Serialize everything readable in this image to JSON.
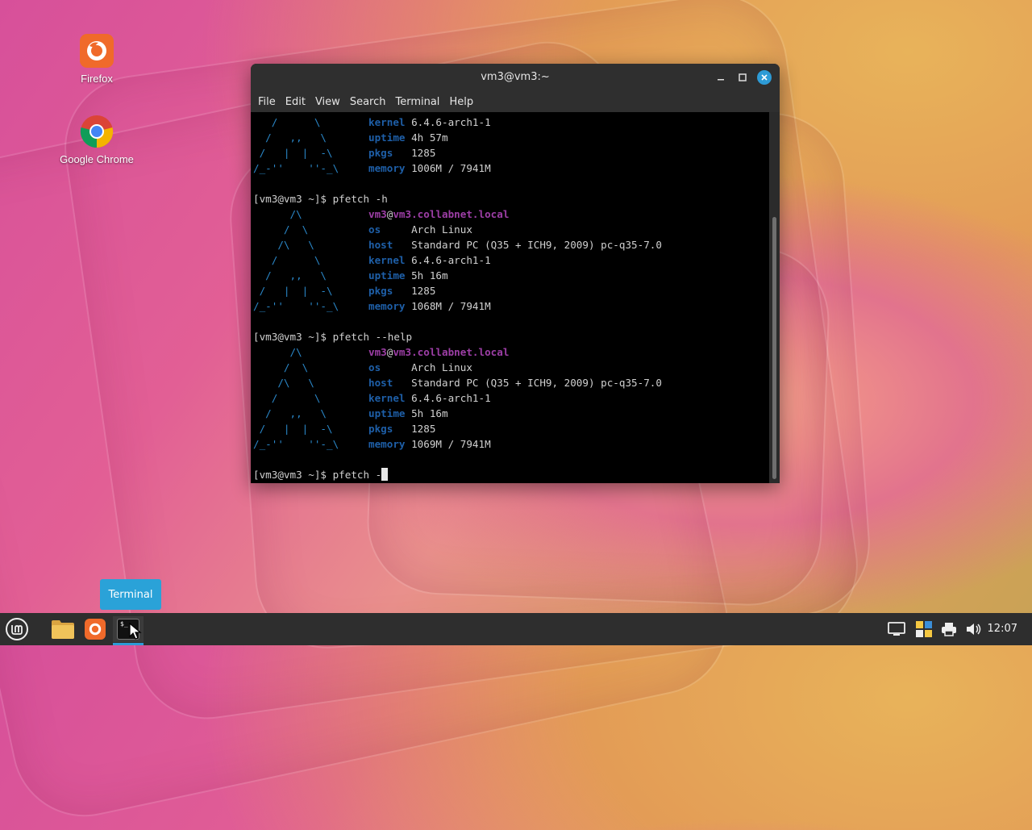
{
  "desktop": {
    "icons": [
      {
        "label": "Firefox"
      },
      {
        "label": "Google Chrome"
      }
    ]
  },
  "window": {
    "title": "vm3@vm3:~",
    "menu": [
      "File",
      "Edit",
      "View",
      "Search",
      "Terminal",
      "Help"
    ]
  },
  "terminal": {
    "block1": [
      {
        "art": "   /      \\",
        "key": "kernel",
        "val": "6.4.6-arch1-1"
      },
      {
        "art": "  /   ,,   \\",
        "key": "uptime",
        "val": "4h 57m"
      },
      {
        "art": " /   |  |  -\\",
        "key": "pkgs  ",
        "val": "1285"
      },
      {
        "art": "/_-''    ''-_\\",
        "key": "memory",
        "val": "1006M / 7941M"
      }
    ],
    "cmd2": "[vm3@vm3 ~]$ pfetch -h",
    "block2": [
      {
        "art": "      /\\",
        "user": "vm3",
        "host": "vm3.collabnet.local"
      },
      {
        "art": "     /  \\",
        "key": "os    ",
        "val": "Arch Linux"
      },
      {
        "art": "    /\\   \\",
        "key": "host  ",
        "val": "Standard PC (Q35 + ICH9, 2009) pc-q35-7.0"
      },
      {
        "art": "   /      \\",
        "key": "kernel",
        "val": "6.4.6-arch1-1"
      },
      {
        "art": "  /   ,,   \\",
        "key": "uptime",
        "val": "5h 16m"
      },
      {
        "art": " /   |  |  -\\",
        "key": "pkgs  ",
        "val": "1285"
      },
      {
        "art": "/_-''    ''-_\\",
        "key": "memory",
        "val": "1068M / 7941M"
      }
    ],
    "cmd3": "[vm3@vm3 ~]$ pfetch --help",
    "block3": [
      {
        "art": "      /\\",
        "user": "vm3",
        "host": "vm3.collabnet.local"
      },
      {
        "art": "     /  \\",
        "key": "os    ",
        "val": "Arch Linux"
      },
      {
        "art": "    /\\   \\",
        "key": "host  ",
        "val": "Standard PC (Q35 + ICH9, 2009) pc-q35-7.0"
      },
      {
        "art": "   /      \\",
        "key": "kernel",
        "val": "6.4.6-arch1-1"
      },
      {
        "art": "  /   ,,   \\",
        "key": "uptime",
        "val": "5h 16m"
      },
      {
        "art": " /   |  |  -\\",
        "key": "pkgs  ",
        "val": "1285"
      },
      {
        "art": "/_-''    ''-_\\",
        "key": "memory",
        "val": "1069M / 7941M"
      }
    ],
    "prompt": "[vm3@vm3 ~]$ pfetch -"
  },
  "tooltip": "Terminal",
  "taskbar": {
    "clock": "12:07",
    "apps": [
      "menu-icon",
      "files-icon",
      "firefox-icon",
      "terminal-icon"
    ],
    "tray": [
      "display-icon",
      "update-icon",
      "printer-icon",
      "volume-icon"
    ]
  },
  "colors": {
    "accent": "#2d9bd6",
    "term_art": "#2a87c8",
    "term_key": "#1e5fa8",
    "term_user": "#9d3ea6"
  }
}
